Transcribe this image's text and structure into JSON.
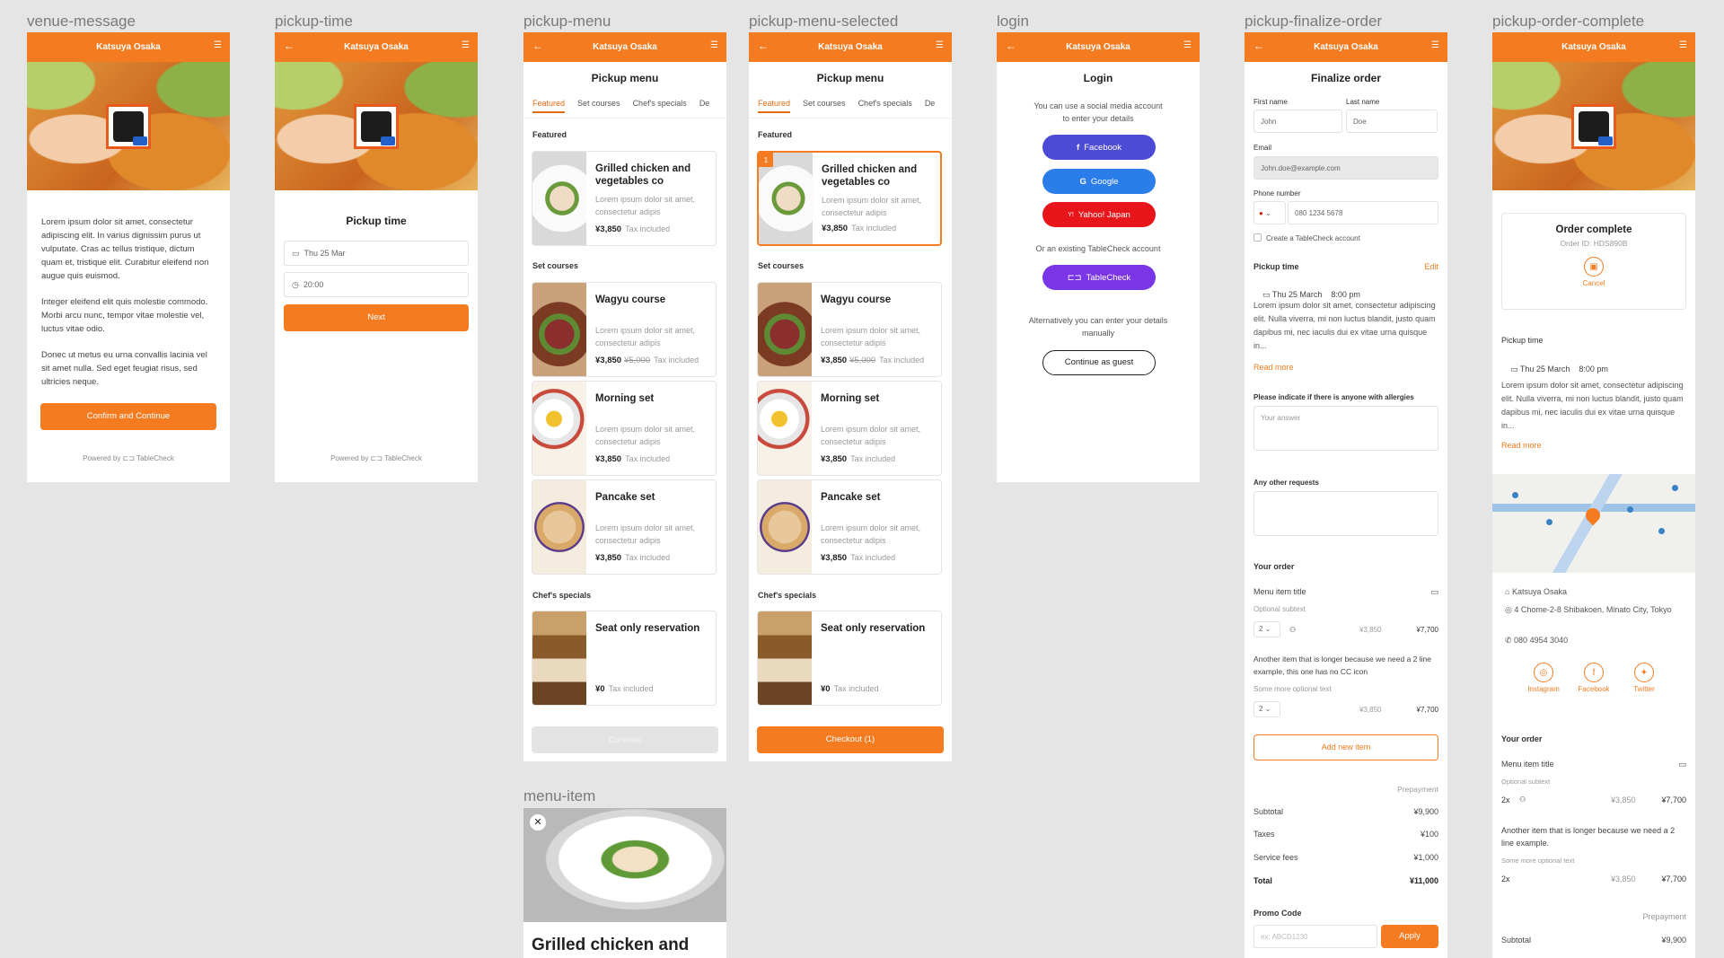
{
  "venue_name": "Katsuya Osaka",
  "frames": {
    "venue_message": "venue-message",
    "pickup_time": "pickup-time",
    "pickup_menu": "pickup-menu",
    "pickup_menu_selected": "pickup-menu-selected",
    "login": "login",
    "pickup_finalize_order": "pickup-finalize-order",
    "pickup_order_complete": "pickup-order-complete",
    "menu_item": "menu-item"
  },
  "venue_message": {
    "para1": "Lorem ipsum dolor sit amet, consectetur adipiscing elit. In varius dignissim purus ut vulputate. Cras ac tellus tristique, dictum quam et, tristique elit. Curabitur eleifend non augue quis euismod.",
    "para2": "Integer eleifend elit quis molestie commodo. Morbi arcu nunc, tempor vitae molestie vel, luctus vitae odio.",
    "para3": "Donec ut metus eu urna convallis lacinia vel sit amet nulla. Sed eget feugiat risus, sed ultricies neque.",
    "confirm_button": "Confirm and Continue",
    "powered_by": "Powered by ⊏⊐ TableCheck"
  },
  "pickup_time": {
    "title": "Pickup time",
    "date": "Thu 25 Mar",
    "time": "20:00",
    "next_button": "Next",
    "powered_by": "Powered by ⊏⊐ TableCheck"
  },
  "menu": {
    "title": "Pickup menu",
    "tabs": [
      "Featured",
      "Set courses",
      "Chef's specials",
      "De"
    ],
    "groups": {
      "featured": "Featured",
      "set_courses": "Set courses",
      "chefs": "Chef's specials"
    },
    "items": [
      {
        "title": "Grilled chicken and vegetables co",
        "desc": "Lorem ipsum dolor sit amet, consectetur adipis",
        "price": "¥3,850",
        "strike": "",
        "tax": "Tax included"
      },
      {
        "title": "Wagyu course",
        "desc": "Lorem ipsum dolor sit amet, consectetur adipis",
        "price": "¥3,850",
        "strike": "¥5,000",
        "tax": "Tax included"
      },
      {
        "title": "Morning set",
        "desc": "Lorem ipsum dolor sit amet, consectetur adipis",
        "price": "¥3,850",
        "strike": "",
        "tax": "Tax included"
      },
      {
        "title": "Pancake set",
        "desc": "Lorem ipsum dolor sit amet, consectetur adipis",
        "price": "¥3,850",
        "strike": "",
        "tax": "Tax included"
      },
      {
        "title": "Seat only reservation",
        "desc": "",
        "price": "¥0",
        "strike": "",
        "tax": "Tax included"
      }
    ],
    "continue_button": "Continue",
    "checkout_button": "Checkout (1)",
    "selected_badge": "1"
  },
  "login": {
    "title": "Login",
    "intro": "You can use a social media account to enter your details",
    "facebook": "Facebook",
    "google": "Google",
    "yahoo": "Yahoo! Japan",
    "or_existing": "Or an existing TableCheck account",
    "tablecheck": "TableCheck",
    "alt_text": "Alternatively you can enter your details manually",
    "guest_button": "Continue as guest"
  },
  "finalize": {
    "title": "Finalize order",
    "first_name_label": "First name",
    "first_name": "John",
    "last_name_label": "Last name",
    "last_name": "Doe",
    "email_label": "Email",
    "email": "John.doe@example.com",
    "phone_label": "Phone number",
    "phone": "080 1234 5678",
    "create_account": "Create a TableCheck account",
    "pickup_time_label": "Pickup time",
    "edit": "Edit",
    "pickup_datetime": "Thu 25 March    8:00 pm",
    "notice": "Lorem ipsum dolor sit amet, consectetur adipiscing elit. Nulla viverra, mi non luctus blandit, justo quam dapibus mi, nec iaculis dui ex vitae urna quisque in...",
    "read_more": "Read more",
    "allergies_label": "Please indicate if there is anyone with allergies",
    "allergies_placeholder": "Your answer",
    "other_requests_label": "Any other requests",
    "your_order": "Your order",
    "item1_title": "Menu item title",
    "item1_subtext": "Optional subtext",
    "item1_qty": "2",
    "item1_unit": "¥3,850",
    "item1_total": "¥7,700",
    "item2_title": "Another item that is longer because we need a 2 line example, this one has no CC icon",
    "item2_subtext": "Some more optional text",
    "item2_qty": "2",
    "item2_unit": "¥3,850",
    "item2_total": "¥7,700",
    "add_item": "Add new item",
    "prepayment": "Prepayment",
    "subtotal_label": "Subtotal",
    "subtotal": "¥9,900",
    "taxes_label": "Taxes",
    "taxes": "¥100",
    "service_label": "Service fees",
    "service": "¥1,000",
    "total_label": "Total",
    "total": "¥11,000",
    "promo_label": "Promo Code",
    "promo_placeholder": "ex: ABCD1230",
    "apply": "Apply"
  },
  "complete": {
    "title": "Order complete",
    "order_id": "Order ID: HDS890B",
    "cancel": "Cancel",
    "pickup_time_label": "Pickup time",
    "pickup_datetime": "Thu 25 March    8:00 pm",
    "notice": "Lorem ipsum dolor sit amet, consectetur adipiscing elit. Nulla viverra, mi non luctus blandit, justo quam dapibus mi, nec iaculis dui ex vitae urna quisque in...",
    "read_more": "Read more",
    "venue": "Katsuya Osaka",
    "address": "4 Chome-2-8 Shibakoen, Minato City, Tokyo",
    "phone": "080 4954 3040",
    "instagram": "Instagram",
    "facebook": "Facebook",
    "twitter": "Twitter",
    "your_order": "Your order",
    "item1_title": "Menu item title",
    "item1_subtext": "Optional subtext",
    "item1_qty": "2x",
    "item1_unit": "¥3,850",
    "item1_total": "¥7,700",
    "item2_title": "Another item that is longer because we need a 2 line example.",
    "item2_subtext": "Some more optional text",
    "item2_qty": "2x",
    "item2_unit": "¥3,850",
    "item2_total": "¥7,700",
    "prepayment": "Prepayment",
    "subtotal_label": "Subtotal",
    "subtotal": "¥9,900"
  },
  "menu_item": {
    "title": "Grilled chicken and"
  }
}
